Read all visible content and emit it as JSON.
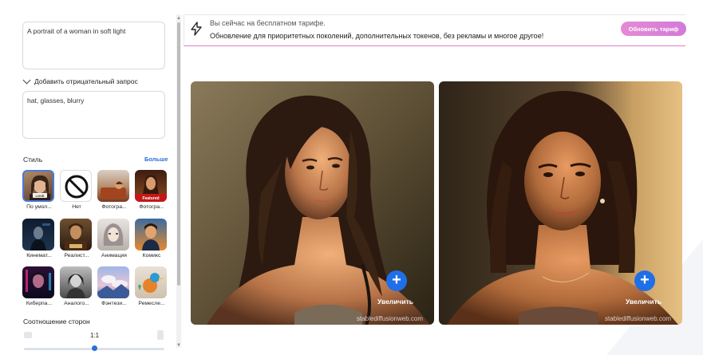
{
  "left_panel": {
    "prompt_text": "A portrait of a woman in soft light",
    "negative_toggle_label": "Добавить отрицательный запрос",
    "negative_text": "hat, glasses, blurry",
    "style_title": "Стиль",
    "style_more": "Больше",
    "styles": [
      {
        "label": "По умол...",
        "icon": "default-style-thumb",
        "selected": true
      },
      {
        "label": "Нет",
        "icon": "none-icon",
        "selected": false
      },
      {
        "label": "Фотогра...",
        "icon": "photo-style-thumb",
        "selected": false
      },
      {
        "label": "Фотогра...",
        "icon": "featured-photo-thumb",
        "badge": "Featured",
        "selected": false
      },
      {
        "label": "Кинемат...",
        "icon": "cinematic-thumb",
        "selected": false
      },
      {
        "label": "Реалист...",
        "icon": "realistic-thumb",
        "selected": false
      },
      {
        "label": "Анимация",
        "icon": "anime-thumb",
        "selected": false
      },
      {
        "label": "Комикс",
        "icon": "comic-thumb",
        "selected": false
      },
      {
        "label": "Киберпа...",
        "icon": "cyberpunk-thumb",
        "selected": false
      },
      {
        "label": "Аналого...",
        "icon": "analog-thumb",
        "selected": false
      },
      {
        "label": "Фэнтези...",
        "icon": "fantasy-thumb",
        "selected": false
      },
      {
        "label": "Ремесле...",
        "icon": "craft-thumb",
        "selected": false
      }
    ],
    "default_badge": "LOVE",
    "ratio_title": "Соотношение сторон",
    "ratio_value": "1:1"
  },
  "banner": {
    "line1": "Вы сейчас на бесплатном тарифе.",
    "line2": "Обновление для приоритетных поколений, дополнительных токенов, без рекламы и многое другое!",
    "upgrade_label": "Обновить тариф"
  },
  "images": [
    {
      "enlarge_label": "Увеличить",
      "watermark": "stablediffusionweb.com"
    },
    {
      "enlarge_label": "Увеличить",
      "watermark": "stablediffusionweb.com"
    }
  ],
  "colors": {
    "accent_blue": "#1f6fe8",
    "upgrade_gradient_start": "#e58bd4",
    "upgrade_gradient_end": "#d27ad9",
    "banner_border": "#d97fc9"
  }
}
